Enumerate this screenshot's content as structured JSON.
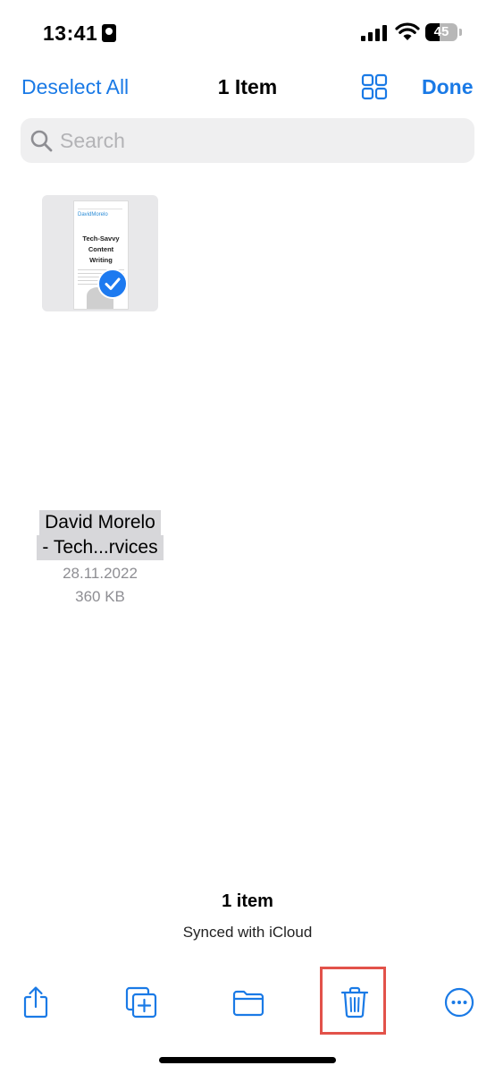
{
  "status_bar": {
    "time": "13:41",
    "battery_level": "45",
    "battery_fraction": 0.45
  },
  "nav": {
    "left_action": "Deselect All",
    "title": "1 Item",
    "done_label": "Done"
  },
  "search": {
    "placeholder": "Search",
    "value": ""
  },
  "file": {
    "name_line1": "David Morelo",
    "name_line2": "- Tech...rvices",
    "date": "28.11.2022",
    "size": "360 KB",
    "selected": true,
    "thumbnail": {
      "logo_text": "DavidMorelo",
      "heading": "Tech-Savvy Content Writing"
    }
  },
  "footer": {
    "count": "1 item",
    "sync_status": "Synced with iCloud"
  },
  "toolbar": {
    "items": [
      "share-icon",
      "duplicate-icon",
      "folder-icon",
      "trash-icon",
      "more-icon"
    ]
  },
  "colors": {
    "accent": "#1a7ae6",
    "highlight": "#e2524a",
    "search_bg": "#efeff0"
  }
}
